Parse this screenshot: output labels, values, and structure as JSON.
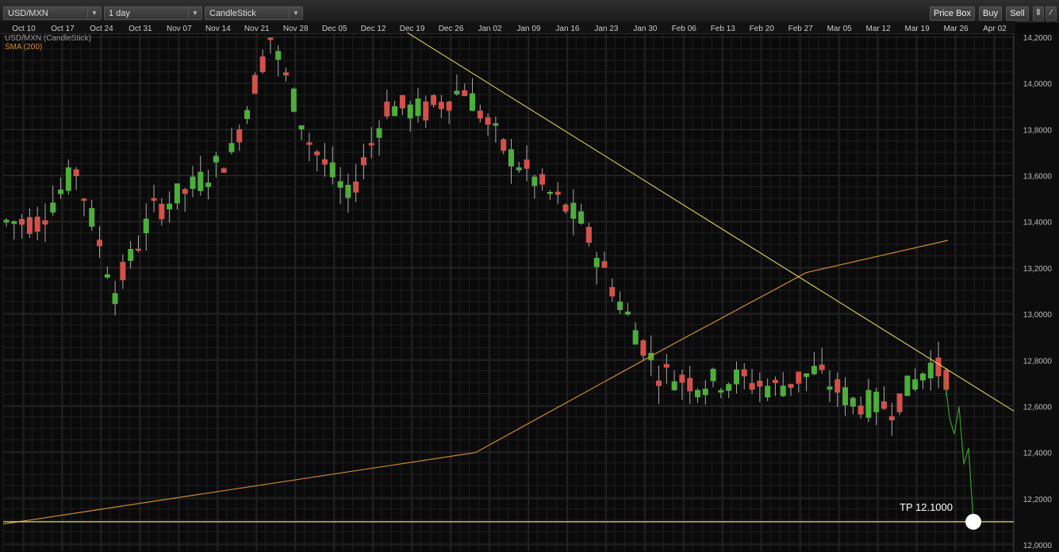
{
  "toolbar": {
    "symbol": "USD/MXN",
    "interval": "1 day",
    "chart_type": "CandleStick",
    "price_box_label": "Price Box",
    "buy_label": "Buy",
    "sell_label": "Sell"
  },
  "legend": {
    "title": "USD/MXN (CandleStick)",
    "sma": "SMA (200)"
  },
  "annotation": {
    "tp_label": "TP 12.1000"
  },
  "colors": {
    "up": "#4caf3a",
    "down": "#d4504a",
    "sma": "#d08a28",
    "trend": "#e8e050",
    "projection": "#3a9a2a",
    "grid": "#2a2a2a"
  },
  "chart_data": {
    "type": "candlestick",
    "x_labels": [
      "Oct 10",
      "Oct 17",
      "Oct 24",
      "Oct 31",
      "Nov 07",
      "Nov 14",
      "Nov 21",
      "Nov 28",
      "Dec 05",
      "Dec 12",
      "Dec 19",
      "Dec 26",
      "Jan 02",
      "Jan 09",
      "Jan 16",
      "Jan 23",
      "Jan 30",
      "Feb 06",
      "Feb 13",
      "Feb 20",
      "Feb 27",
      "Mar 05",
      "Mar 12",
      "Mar 19",
      "Mar 26",
      "Apr 02"
    ],
    "y_ticks": [
      "12,0000",
      "12,2000",
      "12,4000",
      "12,6000",
      "12,8000",
      "13,0000",
      "13,2000",
      "13,4000",
      "13,6000",
      "13,8000",
      "14,0000",
      "14,2000"
    ],
    "ylim": [
      12.0,
      14.2
    ],
    "anchors_week_close": [
      13.4,
      13.62,
      13.1,
      13.45,
      13.55,
      13.7,
      14.2,
      13.75,
      13.5,
      13.9,
      13.88,
      13.98,
      13.72,
      13.55,
      13.4,
      13.05,
      12.75,
      12.7,
      12.72,
      12.68,
      12.75,
      12.62,
      12.6,
      12.78,
      12.66
    ],
    "sma200": [
      [
        0,
        12.09
      ],
      [
        0.5,
        12.4
      ],
      [
        0.7,
        12.85
      ],
      [
        0.85,
        13.18
      ],
      [
        1.0,
        13.32
      ]
    ],
    "trendline": [
      [
        0.4,
        14.22
      ],
      [
        1.0,
        12.58
      ]
    ],
    "tp_level": 12.1,
    "projection_path": [
      12.72,
      12.55,
      12.48,
      12.6,
      12.35,
      12.42,
      12.1
    ]
  }
}
